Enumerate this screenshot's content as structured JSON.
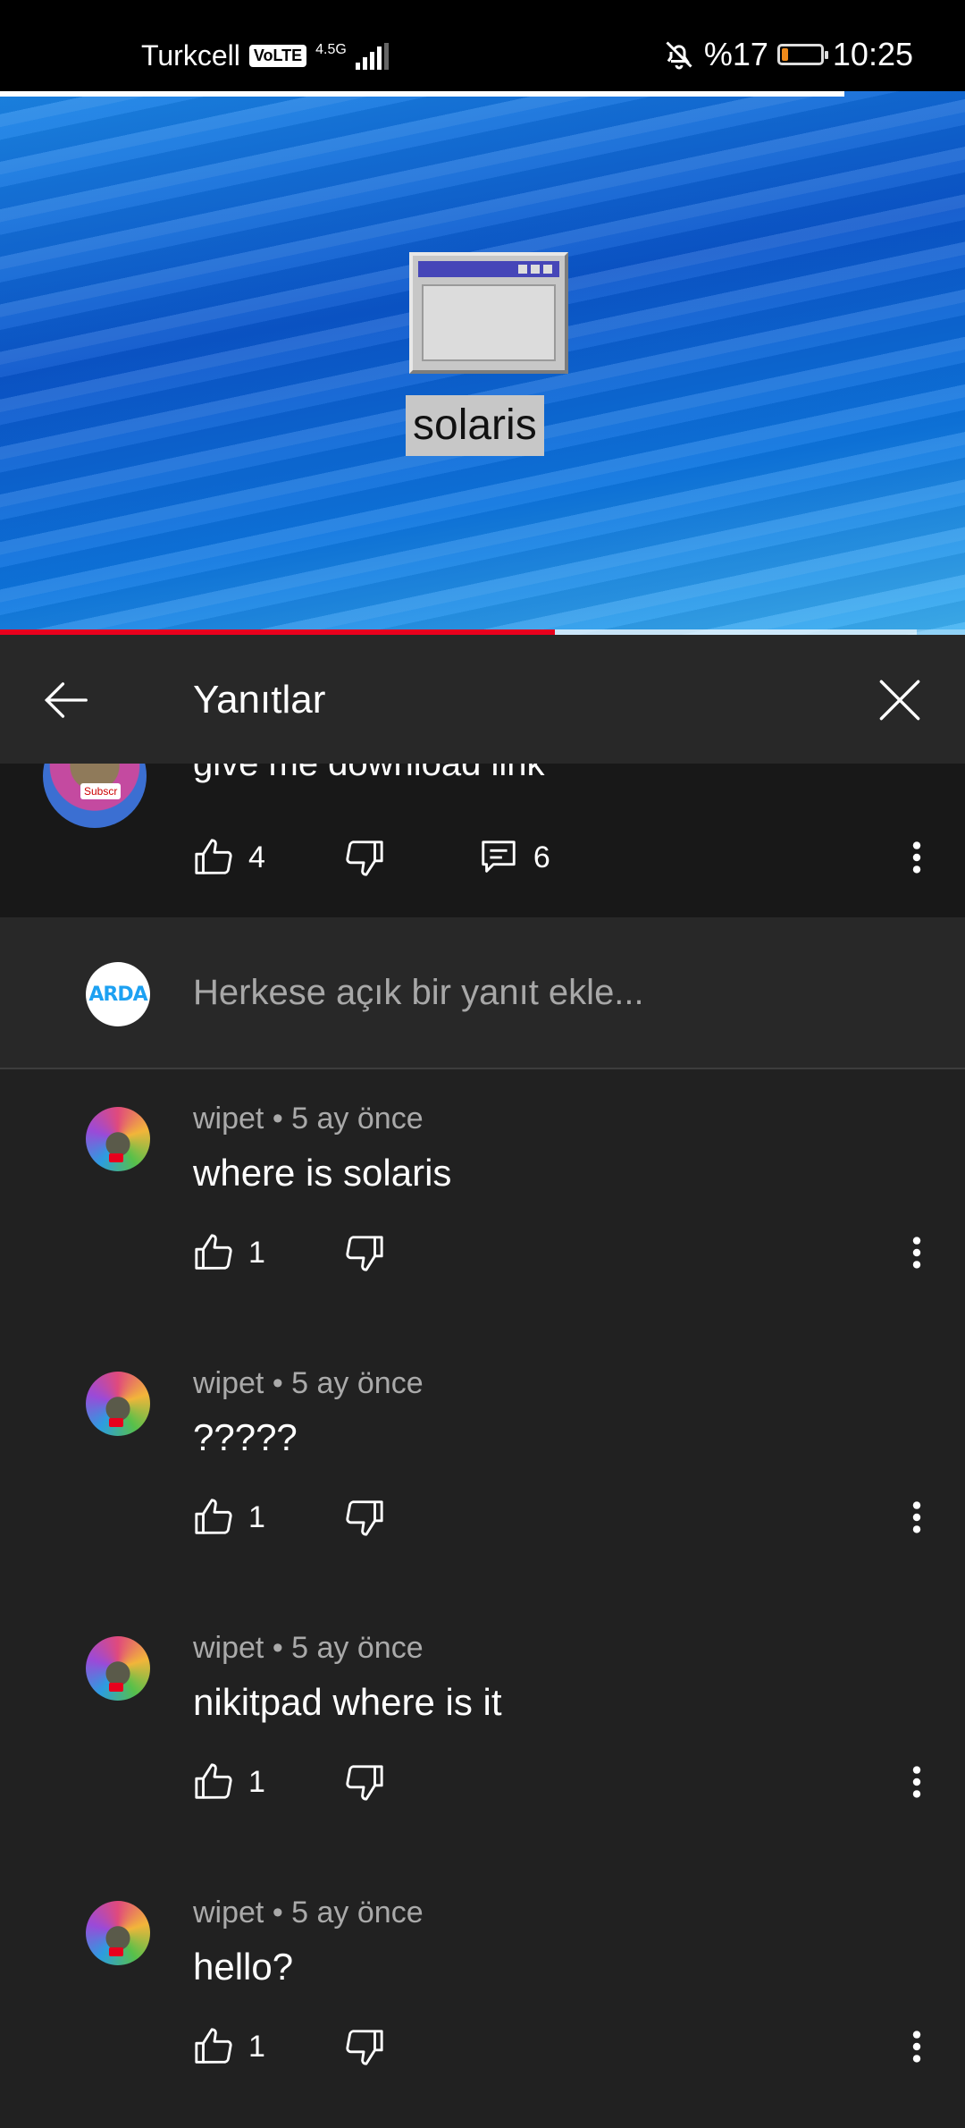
{
  "status_bar": {
    "carrier": "Turkcell",
    "volte": "VoLTE",
    "network": "4.5G",
    "battery_percent": "%17",
    "battery_level": 0.17,
    "time": "10:25",
    "icons": [
      "signal-icon",
      "mute-bell-icon",
      "battery-icon"
    ]
  },
  "video": {
    "label": "solaris",
    "progress_played": 0.575,
    "progress_buffered": 0.95
  },
  "header": {
    "title": "Yanıtlar",
    "back_icon": "arrow-left-icon",
    "close_icon": "close-icon"
  },
  "parent_comment": {
    "text": "give me download link",
    "badge": "Subscr",
    "likes": "4",
    "replies": "6"
  },
  "reply_box": {
    "avatar_text": "ARDA",
    "placeholder": "Herkese açık bir yanıt ekle..."
  },
  "replies": [
    {
      "author": "wipet",
      "time": "5 ay önce",
      "text": "where is solaris",
      "likes": "1"
    },
    {
      "author": "wipet",
      "time": "5 ay önce",
      "text": "?????",
      "likes": "1"
    },
    {
      "author": "wipet",
      "time": "5 ay önce",
      "text": "nikitpad where is it",
      "likes": "1"
    },
    {
      "author": "wipet",
      "time": "5 ay önce",
      "text": "hello?",
      "likes": "1"
    }
  ],
  "separator": " • "
}
